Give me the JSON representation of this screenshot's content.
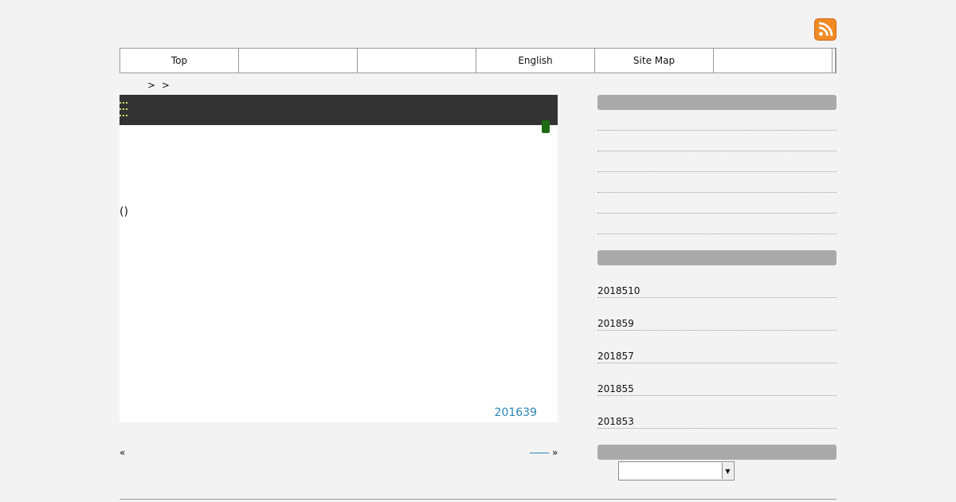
{
  "rss": {
    "icon": "rss-icon"
  },
  "nav": {
    "items": [
      {
        "label": "Top"
      },
      {
        "label": ""
      },
      {
        "label": ""
      },
      {
        "label": "English"
      },
      {
        "label": "Site Map"
      },
      {
        "label": ""
      }
    ]
  },
  "breadcrumb": {
    "text": "> >"
  },
  "main": {
    "paren": "()",
    "date": "201639"
  },
  "pager": {
    "prev": "«",
    "next": "»"
  },
  "sidebar": {
    "archives": [
      "2018510",
      "201859",
      "201857",
      "201855",
      "201853"
    ]
  },
  "colors": {
    "rss": "#f08a24",
    "header_bar": "#333333",
    "link": "#2a86b8",
    "section_head": "#aaaaaa",
    "tag": "#1f6a12"
  }
}
